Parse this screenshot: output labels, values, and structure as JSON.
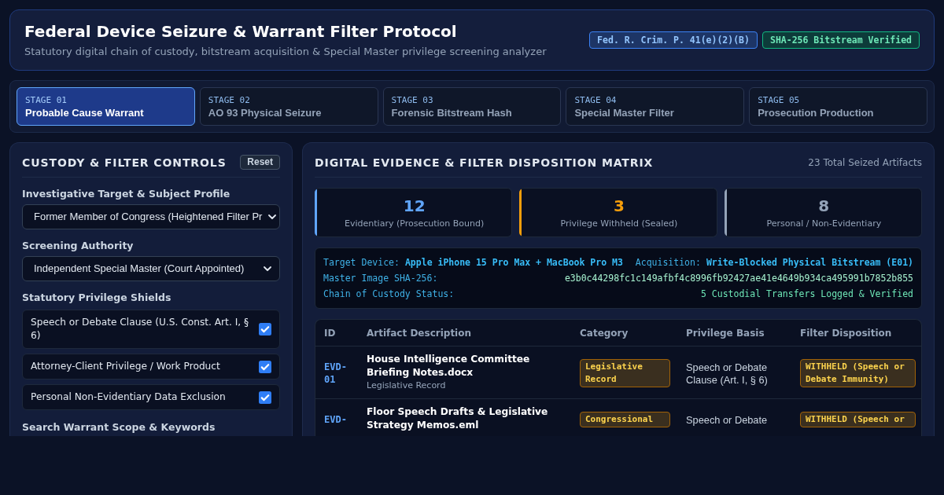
{
  "header": {
    "title": "Federal Device Seizure & Warrant Filter Protocol",
    "subtitle": "Statutory digital chain of custody, bitstream acquisition & Special Master privilege screening analyzer",
    "badges": [
      {
        "text": "Fed. R. Crim. P. 41(e)(2)(B)",
        "kind": "rule"
      },
      {
        "text": "SHA-256 Bitstream Verified",
        "kind": "verified"
      }
    ]
  },
  "stages": [
    {
      "number": "STAGE 01",
      "label": "Probable Cause Warrant",
      "selected": true
    },
    {
      "number": "STAGE 02",
      "label": "AO 93 Physical Seizure",
      "selected": false
    },
    {
      "number": "STAGE 03",
      "label": "Forensic Bitstream Hash",
      "selected": false
    },
    {
      "number": "STAGE 04",
      "label": "Special Master Filter",
      "selected": false
    },
    {
      "number": "STAGE 05",
      "label": "Prosecution Production",
      "selected": false
    }
  ],
  "controls": {
    "title": "CUSTODY & FILTER CONTROLS",
    "reset_button": "Reset",
    "fields": [
      {
        "label": "Investigative Target & Subject Profile",
        "value": "Former Member of Congress (Heightened Filter Pr"
      },
      {
        "label": "Screening Authority",
        "value": "Independent Special Master (Court Appointed)"
      }
    ],
    "shields": {
      "label": "Statutory Privilege Shields",
      "items": [
        {
          "label": "Speech or Debate Clause (U.S. Const. Art. I, § 6)",
          "checked": true
        },
        {
          "label": "Attorney-Client Privilege / Work Product",
          "checked": true
        },
        {
          "label": "Personal Non-Evidentiary Data Exclusion",
          "checked": true
        }
      ]
    },
    "next_section": "Search Warrant Scope & Keywords"
  },
  "matrix": {
    "title": "DIGITAL EVIDENCE & FILTER DISPOSITION MATRIX",
    "total": "23 Total Seized Artifacts",
    "stats": [
      {
        "value": "12",
        "label": "Evidentiary (Prosecution Bound)",
        "color": "#60a5fa"
      },
      {
        "value": "3",
        "label": "Privilege Withheld (Sealed)",
        "color": "#f59e0b"
      },
      {
        "value": "8",
        "label": "Personal / Non-Evidentiary",
        "color": "#94a3b8"
      }
    ],
    "acquisition": [
      {
        "items": [
          {
            "label": "Target Device:",
            "value": "Apple iPhone 15 Pro Max + MacBook Pro M3",
            "kind": "device"
          },
          {
            "label": "Acquisition:",
            "value": "Write-Blocked Physical Bitstream (E01)",
            "kind": "device"
          }
        ]
      },
      {
        "items": [
          {
            "label": "Master Image SHA-256:",
            "value": "e3b0c44298fc1c149afbf4c8996fb92427ae41e4649b934ca495991b7852b855",
            "kind": "hash"
          }
        ]
      },
      {
        "items": [
          {
            "label": "Chain of Custody Status:",
            "value": "5 Custodial Transfers Logged & Verified",
            "kind": "status"
          }
        ]
      }
    ],
    "table": {
      "columns": [
        "ID",
        "Artifact Description",
        "Category",
        "Privilege Basis",
        "Filter Disposition"
      ],
      "rows": [
        {
          "id": "EVD-01",
          "description": "House Intelligence Committee Briefing Notes.docx",
          "subtitle": "Legislative Record",
          "category": "Legislative Record",
          "basis": "Speech or Debate Clause (Art. I, § 6)",
          "disposition": "WITHHELD (Speech or Debate Immunity)"
        },
        {
          "id": "EVD-",
          "description": "Floor Speech Drafts & Legislative Strategy Memos.eml",
          "category": "Congressional",
          "basis": "Speech or Debate",
          "disposition": "WITHHELD (Speech or"
        }
      ]
    }
  }
}
